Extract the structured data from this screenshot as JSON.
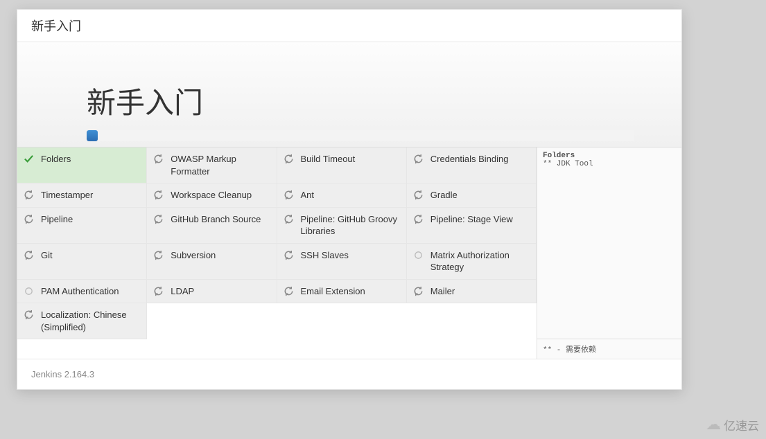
{
  "header": {
    "title": "新手入门"
  },
  "wizard": {
    "title": "新手入门",
    "progress_percent": 2
  },
  "plugins": [
    {
      "label": "Folders",
      "status": "installed"
    },
    {
      "label": "OWASP Markup Formatter",
      "status": "installing"
    },
    {
      "label": "Build Timeout",
      "status": "installing"
    },
    {
      "label": "Credentials Binding",
      "status": "installing"
    },
    {
      "label": "Timestamper",
      "status": "installing"
    },
    {
      "label": "Workspace Cleanup",
      "status": "installing"
    },
    {
      "label": "Ant",
      "status": "installing"
    },
    {
      "label": "Gradle",
      "status": "installing"
    },
    {
      "label": "Pipeline",
      "status": "installing"
    },
    {
      "label": "GitHub Branch Source",
      "status": "installing"
    },
    {
      "label": "Pipeline: GitHub Groovy Libraries",
      "status": "installing"
    },
    {
      "label": "Pipeline: Stage View",
      "status": "installing"
    },
    {
      "label": "Git",
      "status": "installing"
    },
    {
      "label": "Subversion",
      "status": "installing"
    },
    {
      "label": "SSH Slaves",
      "status": "installing"
    },
    {
      "label": "Matrix Authorization Strategy",
      "status": "pending"
    },
    {
      "label": "PAM Authentication",
      "status": "pending"
    },
    {
      "label": "LDAP",
      "status": "installing"
    },
    {
      "label": "Email Extension",
      "status": "installing"
    },
    {
      "label": "Mailer",
      "status": "installing"
    },
    {
      "label": "Localization: Chinese (Simplified)",
      "status": "installing"
    }
  ],
  "log": {
    "line1": "Folders",
    "line2": "** JDK Tool",
    "footer": "** - 需要依赖"
  },
  "footer": {
    "version": "Jenkins 2.164.3"
  },
  "watermark": {
    "text": "亿速云"
  }
}
